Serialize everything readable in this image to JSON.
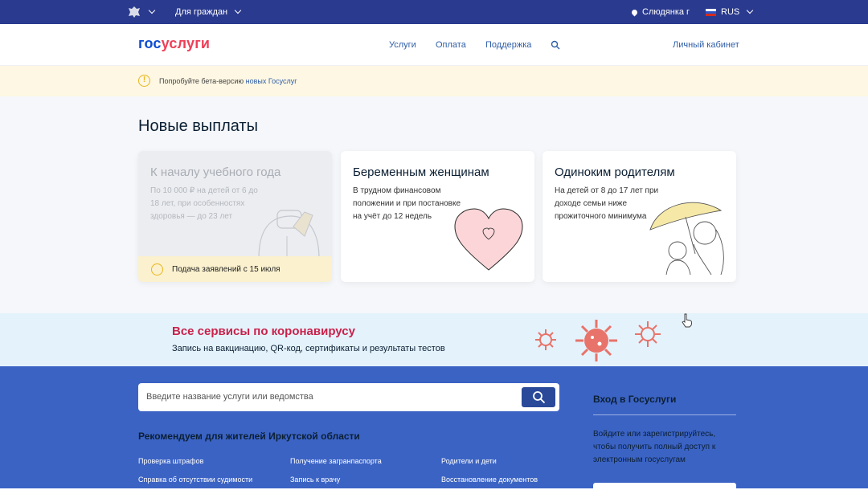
{
  "topbar": {
    "audience": "Для граждан",
    "location": "Слюдянка г",
    "language": "RUS"
  },
  "header": {
    "logo_part1": "гос",
    "logo_part2": "услуги",
    "nav": [
      "Услуги",
      "Оплата",
      "Поддержка"
    ],
    "cabinet": "Личный кабинет"
  },
  "beta": {
    "text": "Попробуйте бета-версию",
    "link": "новых Госуслуг"
  },
  "payments": {
    "title": "Новые выплаты",
    "cards": [
      {
        "title": "К началу учебного года",
        "desc": "По 10 000 ₽ на детей от 6 до 18 лет, при особенностях здоровья — до 23 лет",
        "footer": "Подача заявлений с 15 июля"
      },
      {
        "title": "Беременным женщинам",
        "desc": "В трудном финансовом положении и при постановке на учёт до 12 недель"
      },
      {
        "title": "Одиноким родителям",
        "desc": "На детей от 8 до 17 лет при доходе семьи ниже прожиточного минимума"
      }
    ]
  },
  "covid": {
    "title": "Все сервисы по коронавирусу",
    "subtitle": "Запись на вакцинацию, QR-код, сертификаты и результаты тестов"
  },
  "search": {
    "placeholder": "Введите название услуги или ведомства"
  },
  "recommend": {
    "title": "Рекомендуем для жителей Иркутской области",
    "links": [
      "Проверка штрафов",
      "Получение загранпаспорта",
      "Родители и дети",
      "Справка об отсутствии судимости",
      "Запись к врачу",
      "Восстановление документов"
    ]
  },
  "login": {
    "title": "Вход в Госуслуги",
    "text": "Войдите или зарегистрируйтесь, чтобы получить полный доступ к электронным госуслугам"
  },
  "colors": {
    "topbar": "#2a3a8e",
    "accent": "#0d4cd3",
    "logo_red": "#ee3f58",
    "covid_red": "#c9214a",
    "footer_blue": "#3b63c4"
  }
}
